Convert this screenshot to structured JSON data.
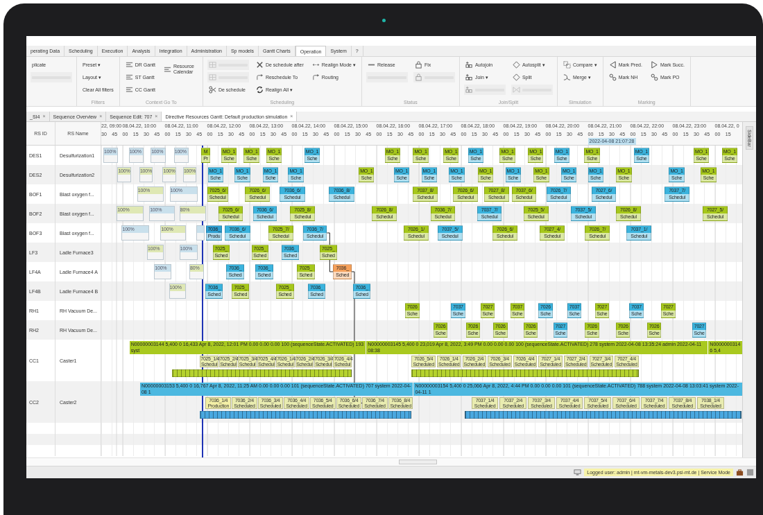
{
  "ribbon_tabs": [
    {
      "label": "perating Data",
      "selected": false
    },
    {
      "label": "Scheduling",
      "selected": false
    },
    {
      "label": "Execution",
      "selected": false
    },
    {
      "label": "Analysis",
      "selected": false
    },
    {
      "label": "Integration",
      "selected": false
    },
    {
      "label": "Administration",
      "selected": false
    },
    {
      "label": "Sp models",
      "selected": false
    },
    {
      "label": "Gantt Charts",
      "selected": false
    },
    {
      "label": "Operation",
      "selected": true
    },
    {
      "label": "System",
      "selected": false
    },
    {
      "label": "?",
      "selected": false
    }
  ],
  "ribbon_groups": [
    {
      "columns": [
        [
          {
            "label": "plicate",
            "disabled": false
          },
          {
            "disabled": true
          }
        ]
      ]
    },
    {
      "label": "Filters",
      "columns": [
        [
          {
            "label": "Preset ▾",
            "disabled": false
          },
          {
            "label": "Layout ▾",
            "disabled": false
          },
          {
            "label": "Clear All filters",
            "disabled": false
          }
        ]
      ]
    },
    {
      "label": "Context Go To",
      "columns": [
        [
          {
            "label": "DR Gantt",
            "disabled": false
          },
          {
            "label": "ST Gantt",
            "disabled": false
          },
          {
            "label": "CC Gantt",
            "disabled": false
          }
        ],
        [
          {
            "label": "Resource Calendar",
            "disabled": false
          }
        ]
      ]
    },
    {
      "label": "Scheduling",
      "columns": [
        [
          {
            "disabled": true
          },
          {
            "disabled": true
          },
          {
            "label": "De schedule",
            "disabled": false
          }
        ],
        [
          {
            "label": "De schedule after",
            "disabled": false
          },
          {
            "label": "Reschedule To",
            "disabled": false
          },
          {
            "label": "Realign All ▾",
            "disabled": false
          }
        ],
        [
          {
            "label": "Realign Mode ▾",
            "disabled": false
          },
          {
            "label": "Routing",
            "disabled": false
          }
        ]
      ]
    },
    {
      "label": "Status",
      "columns": [
        [
          {
            "label": "Release",
            "disabled": false
          },
          {
            "disabled": true
          }
        ],
        [
          {
            "label": "Fix",
            "disabled": false
          },
          {
            "disabled": true
          }
        ]
      ]
    },
    {
      "label": "Join/Split",
      "columns": [
        [
          {
            "label": "Autojoin",
            "disabled": false
          },
          {
            "label": "Join ▾",
            "disabled": false
          },
          {
            "disabled": true
          }
        ],
        [
          {
            "label": "Autosplit ▾",
            "disabled": false
          },
          {
            "label": "Split",
            "disabled": false
          },
          {
            "disabled": true
          }
        ]
      ]
    },
    {
      "label": "Simulation",
      "columns": [
        [
          {
            "label": "Compare ▾",
            "disabled": false
          },
          {
            "label": "Merge ▾",
            "disabled": false
          }
        ]
      ]
    },
    {
      "label": "Marking",
      "columns": [
        [
          {
            "label": "Mark Pred.",
            "disabled": false
          },
          {
            "label": "Mark NH",
            "disabled": false
          }
        ],
        [
          {
            "label": "Mark Succ.",
            "disabled": false
          },
          {
            "label": "Mark PO",
            "disabled": false
          }
        ]
      ]
    }
  ],
  "document_tabs": [
    {
      "label": "_SI4",
      "close": "×",
      "selected": false
    },
    {
      "label": "Sequence Overview",
      "close": "×",
      "selected": false
    },
    {
      "label": "Sequence Edit: 707",
      "close": "×",
      "selected": false
    },
    {
      "label": "Directive Resources Gantt: Default production simulation",
      "close": "×",
      "selected": true
    }
  ],
  "gantt": {
    "columns": [
      "RS ID",
      "RS Name"
    ],
    "hours": [
      {
        "label": "22, 09:00",
        "minutes": [
          "30",
          "45"
        ]
      },
      {
        "label": "08.04.22, 10:00",
        "minutes": [
          "00",
          "15",
          "30",
          "45"
        ]
      },
      {
        "label": "08.04.22, 11:00",
        "minutes": [
          "00",
          "15",
          "30",
          "45"
        ]
      },
      {
        "label": "08.04.22, 12:00",
        "minutes": [
          "00",
          "15",
          "30",
          "45"
        ]
      },
      {
        "label": "08.04.22, 13:00",
        "minutes": [
          "00",
          "15",
          "30",
          "45"
        ]
      },
      {
        "label": "08.04.22, 14:00",
        "minutes": [
          "00",
          "15",
          "30",
          "45"
        ]
      },
      {
        "label": "08.04.22, 15:00",
        "minutes": [
          "00",
          "15",
          "30",
          "45"
        ]
      },
      {
        "label": "08.04.22, 16:00",
        "minutes": [
          "00",
          "15",
          "30",
          "45"
        ]
      },
      {
        "label": "08.04.22, 17:00",
        "minutes": [
          "00",
          "15",
          "30",
          "45"
        ]
      },
      {
        "label": "08.04.22, 18:00",
        "minutes": [
          "00",
          "15",
          "30",
          "45"
        ]
      },
      {
        "label": "08.04.22, 19:00",
        "minutes": [
          "00",
          "15",
          "30",
          "45"
        ]
      },
      {
        "label": "08.04.22, 20:00",
        "minutes": [
          "00",
          "15",
          "30",
          "45"
        ]
      },
      {
        "label": "08.04.22, 21:00",
        "minutes": [
          "00",
          "15",
          "30",
          "45"
        ]
      },
      {
        "label": "08.04.22, 22:00",
        "minutes": [
          "00",
          "15",
          "30",
          "45"
        ]
      },
      {
        "label": "08.04.22, 23:00",
        "minutes": [
          "00",
          "15",
          "30",
          "45"
        ]
      },
      {
        "label": "08.04.22, 0",
        "minutes": [
          "00",
          "15"
        ]
      }
    ],
    "now_marker": {
      "label": "2022-04-08 21:07:28"
    },
    "rows": [
      {
        "id": "DES1",
        "name": "Desulfurization1",
        "kind": "unit",
        "bars": [
          {
            "kind": "past",
            "color": "#c9e0ec",
            "lines": [
              "100%"
            ]
          },
          {
            "kind": "past",
            "color": "#c9e0ec",
            "lines": [
              "100%"
            ]
          },
          {
            "kind": "past",
            "color": "#c9e0ec",
            "lines": [
              "100%"
            ]
          },
          {
            "kind": "past",
            "color": "#c9e0ec",
            "lines": [
              "100%"
            ]
          },
          {
            "kind": "job",
            "color": "#a6c71b",
            "lines": [
              "M",
              "Pr"
            ]
          },
          {
            "kind": "job",
            "color": "#a6c71b",
            "lines": [
              "MO_1",
              "Sche"
            ]
          },
          {
            "kind": "job",
            "color": "#a6c71b",
            "lines": [
              "MO_1",
              "Sche"
            ]
          },
          {
            "kind": "job",
            "color": "#a6c71b",
            "lines": [
              "MO_1",
              "Sche"
            ]
          },
          {
            "kind": "job",
            "color": "#3bb3dd",
            "lines": [
              "MO_1",
              "Sche"
            ]
          },
          {
            "kind": "job",
            "color": "#a6c71b",
            "lines": [
              "MO_1",
              "Sche"
            ]
          },
          {
            "kind": "job",
            "color": "#a6c71b",
            "lines": [
              "MO_1",
              "Sche"
            ]
          },
          {
            "kind": "job",
            "color": "#a6c71b",
            "lines": [
              "MO_1",
              "Sche"
            ]
          },
          {
            "kind": "job",
            "color": "#3bb3dd",
            "lines": [
              "MO_1",
              "Sche"
            ]
          },
          {
            "kind": "job",
            "color": "#a6c71b",
            "lines": [
              "MO_1",
              "Sche"
            ]
          },
          {
            "kind": "job",
            "color": "#a6c71b",
            "lines": [
              "MO_1",
              "Sche"
            ]
          },
          {
            "kind": "job",
            "color": "#3bb3dd",
            "lines": [
              "MO_1",
              "Sche"
            ]
          },
          {
            "kind": "job",
            "color": "#a6c71b",
            "lines": [
              "MO_1",
              "Sche"
            ]
          },
          {
            "kind": "job",
            "color": "#3bb3dd",
            "lines": [
              "MO_1",
              "Sche"
            ]
          },
          {
            "kind": "job",
            "color": "#a6c71b",
            "lines": [
              "MO_1",
              "Sche"
            ]
          },
          {
            "kind": "job",
            "color": "#a6c71b",
            "lines": [
              "MO_1",
              "Sche"
            ]
          }
        ]
      },
      {
        "id": "DES2",
        "name": "Desulfurization2",
        "kind": "unit",
        "bars": [
          {
            "kind": "past",
            "color": "#dfe8b4",
            "lines": [
              "100%"
            ]
          },
          {
            "kind": "past",
            "color": "#dfe8b4",
            "lines": [
              "100%"
            ]
          },
          {
            "kind": "past",
            "color": "#dfe8b4",
            "lines": [
              "100%"
            ]
          },
          {
            "kind": "past",
            "color": "#dfe8b4",
            "lines": [
              "100%"
            ]
          },
          {
            "kind": "job",
            "color": "#3bb3dd",
            "lines": [
              "MO_1",
              "Sche"
            ]
          },
          {
            "kind": "job",
            "color": "#3bb3dd",
            "lines": [
              "MO_1",
              "Sche"
            ]
          },
          {
            "kind": "job",
            "color": "#3bb3dd",
            "lines": [
              "MO_1",
              "Sche"
            ]
          },
          {
            "kind": "job",
            "color": "#3bb3dd",
            "lines": [
              "MO_1",
              "Sche"
            ]
          },
          {
            "kind": "job",
            "color": "#a6c71b",
            "lines": [
              "MO_1",
              "Sche"
            ]
          },
          {
            "kind": "job",
            "color": "#3bb3dd",
            "lines": [
              "MO_1",
              "Sche"
            ]
          },
          {
            "kind": "job",
            "color": "#3bb3dd",
            "lines": [
              "MO_1",
              "Sche"
            ]
          },
          {
            "kind": "job",
            "color": "#3bb3dd",
            "lines": [
              "MO_1",
              "Sche"
            ]
          },
          {
            "kind": "job",
            "color": "#a6c71b",
            "lines": [
              "MO_1",
              "Sche"
            ]
          },
          {
            "kind": "job",
            "color": "#3bb3dd",
            "lines": [
              "MO_1",
              "Sche"
            ]
          },
          {
            "kind": "job",
            "color": "#a6c71b",
            "lines": [
              "MO_1",
              "Sche"
            ]
          },
          {
            "kind": "job",
            "color": "#3bb3dd",
            "lines": [
              "MO_1",
              "Sche"
            ]
          },
          {
            "kind": "job",
            "color": "#3bb3dd",
            "lines": [
              "MO_1",
              "Sche"
            ]
          },
          {
            "kind": "job",
            "color": "#a6c71b",
            "lines": [
              "MO_1",
              "Sche"
            ]
          },
          {
            "kind": "job",
            "color": "#3bb3dd",
            "lines": [
              "MO_1",
              "Sche"
            ]
          },
          {
            "kind": "job",
            "color": "#a6c71b",
            "lines": [
              "MO_1",
              "Sche"
            ]
          }
        ]
      },
      {
        "id": "BOF1",
        "name": "Blast oxygen f...",
        "kind": "unit",
        "bars": [
          {
            "kind": "past",
            "color": "#dfe8b4",
            "lines": [
              "100%"
            ]
          },
          {
            "kind": "past",
            "color": "#c9e0ec",
            "lines": [
              "100%"
            ]
          },
          {
            "kind": "job",
            "color": "#a6c71b",
            "lines": [
              "7025_6/",
              "Schedul"
            ]
          },
          {
            "kind": "job",
            "color": "#a6c71b",
            "lines": [
              "7026_6/",
              "Schedul"
            ]
          },
          {
            "kind": "job",
            "color": "#3bb3dd",
            "lines": [
              "7036_6/",
              "Schedul"
            ]
          },
          {
            "kind": "job",
            "color": "#3bb3dd",
            "lines": [
              "7036_8/",
              "Schedul"
            ]
          },
          {
            "kind": "job",
            "color": "#a6c71b",
            "lines": [
              "7037_8/",
              "Schedul"
            ]
          },
          {
            "kind": "job",
            "color": "#a6c71b",
            "lines": [
              "7026_6/",
              "Schedul"
            ]
          },
          {
            "kind": "job",
            "color": "#a6c71b",
            "lines": [
              "7027_8/",
              "Schedul"
            ]
          },
          {
            "kind": "job",
            "color": "#a6c71b",
            "lines": [
              "7037_6/",
              "Schedul"
            ]
          },
          {
            "kind": "job",
            "color": "#3bb3dd",
            "lines": [
              "7026_7/",
              "Schedul"
            ]
          },
          {
            "kind": "job",
            "color": "#3bb3dd",
            "lines": [
              "7027_6/",
              "Schedul"
            ]
          },
          {
            "kind": "job",
            "color": "#3bb3dd",
            "lines": [
              "7037_7/",
              "Schedul"
            ]
          }
        ]
      },
      {
        "id": "BOF2",
        "name": "Blast oxygen f...",
        "kind": "unit",
        "bars": [
          {
            "kind": "past",
            "color": "#dfe8b4",
            "lines": [
              "100%"
            ]
          },
          {
            "kind": "past",
            "color": "#c9e0ec",
            "lines": [
              "100%"
            ]
          },
          {
            "kind": "past",
            "color": "#dfe8b4",
            "lines": [
              "80%"
            ]
          },
          {
            "kind": "job",
            "color": "#a6c71b",
            "lines": [
              "7025_6/",
              "Schedul"
            ]
          },
          {
            "kind": "job",
            "color": "#3bb3dd",
            "lines": [
              "7036_6/",
              "Schedul"
            ]
          },
          {
            "kind": "job",
            "color": "#a6c71b",
            "lines": [
              "7025_8/",
              "Schedul"
            ]
          },
          {
            "kind": "job",
            "color": "#a6c71b",
            "lines": [
              "7026_8/",
              "Schedul"
            ]
          },
          {
            "kind": "job",
            "color": "#a6c71b",
            "lines": [
              "7036_7/",
              "Schedul"
            ]
          },
          {
            "kind": "job",
            "color": "#3bb3dd",
            "lines": [
              "7037_7/",
              "Schedul"
            ]
          },
          {
            "kind": "job",
            "color": "#a6c71b",
            "lines": [
              "7025_5/",
              "Schedul"
            ]
          },
          {
            "kind": "job",
            "color": "#3bb3dd",
            "lines": [
              "7037_5/",
              "Schedul"
            ]
          },
          {
            "kind": "job",
            "color": "#a6c71b",
            "lines": [
              "7026_8/",
              "Schedul"
            ]
          },
          {
            "kind": "job",
            "color": "#a6c71b",
            "lines": [
              "7027_5/",
              "Schedul"
            ]
          }
        ]
      },
      {
        "id": "BOF3",
        "name": "Blast oxygen f...",
        "kind": "unit",
        "bars": [
          {
            "kind": "past",
            "color": "#c9e0ec",
            "lines": [
              "100%"
            ]
          },
          {
            "kind": "past",
            "color": "#dfe8b4",
            "lines": [
              "100%"
            ]
          },
          {
            "kind": "past",
            "color": "#c9e0ec"
          },
          {
            "kind": "job",
            "color": "#2e9fd2",
            "lines": [
              "7036_",
              "Produ"
            ]
          },
          {
            "kind": "job",
            "color": "#3bb3dd",
            "lines": [
              "7036_6/",
              "Schedul"
            ]
          },
          {
            "kind": "job",
            "color": "#a6c71b",
            "lines": [
              "7025_7/",
              "Schedul"
            ]
          },
          {
            "kind": "job",
            "color": "#3bb3dd",
            "lines": [
              "7036_7/",
              "Schedul"
            ]
          },
          {
            "kind": "job",
            "color": "#a6c71b",
            "lines": [
              "7026_1/",
              "Schedul"
            ]
          },
          {
            "kind": "job",
            "color": "#3bb3dd",
            "lines": [
              "7037_5/",
              "Schedul"
            ]
          },
          {
            "kind": "job",
            "color": "#a6c71b",
            "lines": [
              "7026_6/",
              "Schedul"
            ]
          },
          {
            "kind": "job",
            "color": "#a6c71b",
            "lines": [
              "7027_4/",
              "Schedul"
            ]
          },
          {
            "kind": "job",
            "color": "#a6c71b",
            "lines": [
              "7026_7/",
              "Schedul"
            ]
          },
          {
            "kind": "job",
            "color": "#3bb3dd",
            "lines": [
              "7037_1/",
              "Schedul"
            ]
          }
        ]
      },
      {
        "id": "LF3",
        "name": "Ladle Furnace3",
        "kind": "unit",
        "bars": [
          {
            "kind": "past",
            "color": "#dfe8b4",
            "lines": [
              "100%"
            ]
          },
          {
            "kind": "past",
            "color": "#c9e0ec",
            "lines": [
              "100%"
            ]
          },
          {
            "kind": "job",
            "color": "#a6c71b",
            "lines": [
              "7025_",
              "Sched"
            ]
          },
          {
            "kind": "job",
            "color": "#a6c71b",
            "lines": [
              "7025_",
              "Sched"
            ]
          },
          {
            "kind": "job",
            "color": "#3bb3dd",
            "lines": [
              "7036_",
              "Sched"
            ]
          },
          {
            "kind": "job",
            "color": "#a6c71b",
            "lines": [
              "7025_",
              "Sched"
            ]
          }
        ]
      },
      {
        "id": "LF4A",
        "name": "Ladle Furnace4 A",
        "kind": "unit",
        "bars": [
          {
            "kind": "past",
            "color": "#c9e0ec",
            "lines": [
              "100%"
            ]
          },
          {
            "kind": "past",
            "color": "#dfe8b4",
            "lines": [
              "80%"
            ]
          },
          {
            "kind": "job",
            "color": "#3bb3dd",
            "lines": [
              "7036_",
              "Sched"
            ]
          },
          {
            "kind": "job",
            "color": "#3bb3dd",
            "lines": [
              "7036_",
              "Sched"
            ]
          },
          {
            "kind": "job",
            "color": "#a6c71b",
            "lines": [
              "7025_",
              "Sched"
            ]
          },
          {
            "kind": "job",
            "color": "#f5a05a",
            "lines": [
              "7036_",
              "Sched"
            ]
          }
        ]
      },
      {
        "id": "LF4B",
        "name": "Ladle Furnace4 B",
        "kind": "unit",
        "bars": [
          {
            "kind": "past",
            "color": "#dfe8b4",
            "lines": [
              "100%"
            ]
          },
          {
            "kind": "job",
            "color": "#3bb3dd",
            "lines": [
              "7036_",
              "Sched"
            ]
          },
          {
            "kind": "job",
            "color": "#a6c71b",
            "lines": [
              "7025_",
              "Sched"
            ]
          },
          {
            "kind": "job",
            "color": "#a6c71b",
            "lines": [
              "7025_",
              "Sched"
            ]
          },
          {
            "kind": "job",
            "color": "#3bb3dd",
            "lines": [
              "7036_",
              "Sched"
            ]
          },
          {
            "kind": "job",
            "color": "#3bb3dd",
            "lines": [
              "7036_",
              "Sched"
            ]
          }
        ]
      },
      {
        "id": "RH1",
        "name": "RH Vacuum De...",
        "kind": "unit",
        "bars": [
          {
            "kind": "job",
            "color": "#a6c71b",
            "lines": [
              "7026",
              "Sche"
            ]
          },
          {
            "kind": "job",
            "color": "#3bb3dd",
            "lines": [
              "7037",
              "Sche"
            ]
          },
          {
            "kind": "job",
            "color": "#a6c71b",
            "lines": [
              "7027",
              "Sche"
            ]
          },
          {
            "kind": "job",
            "color": "#a6c71b",
            "lines": [
              "7037",
              "Sche"
            ]
          },
          {
            "kind": "job",
            "color": "#3bb3dd",
            "lines": [
              "7026",
              "Sche"
            ]
          },
          {
            "kind": "job",
            "color": "#3bb3dd",
            "lines": [
              "7037",
              "Sche"
            ]
          },
          {
            "kind": "job",
            "color": "#a6c71b",
            "lines": [
              "7027",
              "Sche"
            ]
          },
          {
            "kind": "job",
            "color": "#3bb3dd",
            "lines": [
              "7037",
              "Sche"
            ]
          },
          {
            "kind": "job",
            "color": "#a6c71b",
            "lines": [
              "7027",
              "Sche"
            ]
          }
        ]
      },
      {
        "id": "RH2",
        "name": "RH Vacuum De...",
        "kind": "unit",
        "bars": [
          {
            "kind": "job",
            "color": "#a6c71b",
            "lines": [
              "7026",
              "Sche"
            ]
          },
          {
            "kind": "job",
            "color": "#a6c71b",
            "lines": [
              "7026",
              "Sche"
            ]
          },
          {
            "kind": "job",
            "color": "#a6c71b",
            "lines": [
              "7026",
              "Sche"
            ]
          },
          {
            "kind": "job",
            "color": "#a6c71b",
            "lines": [
              "7026",
              "Sche"
            ]
          },
          {
            "kind": "job",
            "color": "#3bb3dd",
            "lines": [
              "7027",
              "Sche"
            ]
          },
          {
            "kind": "job",
            "color": "#a6c71b",
            "lines": [
              "7026",
              "Sche"
            ]
          },
          {
            "kind": "job",
            "color": "#a6c71b",
            "lines": [
              "7026",
              "Sche"
            ]
          },
          {
            "kind": "job",
            "color": "#a6c71b",
            "lines": [
              "7026",
              "Sche"
            ]
          },
          {
            "kind": "job",
            "color": "#3bb3dd",
            "lines": [
              "7027",
              "Sche"
            ]
          }
        ]
      },
      {
        "id": "CC1",
        "name": "Caster1",
        "kind": "caster",
        "sequences": [
          {
            "color": "#a9c91f",
            "text": "N00000003144 5,400 0 16,433 Apr 8, 2022, 12:01 PM 0.00 0.00 0.00 100 (sequenceState.ACTIVATED) 193 syst"
          },
          {
            "color": "#a9c91f",
            "text": "N00000003145 5,400 0 23,019 Apr 8, 2022, 3:49 PM 0.00 0.00 0.00 100 (sequenceState.ACTIVATED) 278 system 2022-04-08 13:35:24 admin 2022-04-11 08:38"
          },
          {
            "color": "#a9c91f",
            "text": "N00000003146 5,4"
          }
        ],
        "jobs": [
          {
            "color": "#e9ecb0",
            "lines": [
              "7025_1/4",
              "Schedul"
            ]
          },
          {
            "color": "#e9ecb0",
            "lines": [
              "7025_2/4",
              "Schedul"
            ]
          },
          {
            "color": "#e9ecb0",
            "lines": [
              "7025_3/4",
              "Schedul"
            ]
          },
          {
            "color": "#e9ecb0",
            "lines": [
              "7025_4/4",
              "Schedul"
            ]
          },
          {
            "color": "#e9ecb0",
            "lines": [
              "7026_1/4",
              "Schedul"
            ]
          },
          {
            "color": "#e9ecb0",
            "lines": [
              "7026_2/4",
              "Schedul"
            ]
          },
          {
            "color": "#e9ecb0",
            "lines": [
              "7026_3/4",
              "Schedul"
            ]
          },
          {
            "color": "#e9ecb0",
            "lines": [
              "7026_4/4",
              "Schedul"
            ]
          },
          {
            "color": "#e9ecb0",
            "lines": [
              "7026_5/4",
              "Scheduled"
            ]
          },
          {
            "color": "#e9ecb0",
            "lines": [
              "7026_1/4",
              "Scheduled"
            ]
          },
          {
            "color": "#e9ecb0",
            "lines": [
              "7026_2/4",
              "Scheduled"
            ]
          },
          {
            "color": "#e9ecb0",
            "lines": [
              "7026_3/4",
              "Scheduled"
            ]
          },
          {
            "color": "#e9ecb0",
            "lines": [
              "7026_4/4",
              "Scheduled"
            ]
          },
          {
            "color": "#e9ecb0",
            "lines": [
              "7027_1/4",
              "Scheduled"
            ]
          },
          {
            "color": "#e9ecb0",
            "lines": [
              "7027_2/4",
              "Scheduled"
            ]
          },
          {
            "color": "#e9ecb0",
            "lines": [
              "7027_3/4",
              "Scheduled"
            ]
          },
          {
            "color": "#e9ecb0",
            "lines": [
              "7027_4/4",
              "Scheduled"
            ]
          }
        ],
        "strips": [
          {
            "color": "#b5d22e"
          },
          {
            "color": "#b5d22e"
          }
        ]
      },
      {
        "id": "CC2",
        "name": "Caster2",
        "kind": "caster",
        "sequences": [
          {
            "color": "#4cb8e0",
            "text": "N00000003153 5,400 0 16,767 Apr 8, 2022, 11:25 AM 0.00 0.00 0.00 101 (sequenceState.ACTIVATED) 707 system 2022-04-08 1"
          },
          {
            "color": "#4cb8e0",
            "text": "N00000003154 5,400 0 25,066 Apr 8, 2022, 4:44 PM 0.00 0.00 0.00 101 (sequenceState.ACTIVATED) 788 system 2022-04-08 13:03:41 system 2022-04-11 1"
          }
        ],
        "jobs": [
          {
            "color": "#f3efa6",
            "lines": [
              "7036_1/4",
              "Production"
            ]
          },
          {
            "color": "#e9ecb0",
            "lines": [
              "7036_2/4",
              "Scheduled"
            ]
          },
          {
            "color": "#e9ecb0",
            "lines": [
              "7036_3/4",
              "Scheduled"
            ]
          },
          {
            "color": "#e9ecb0",
            "lines": [
              "7036_4/4",
              "Scheduled"
            ]
          },
          {
            "color": "#e9ecb0",
            "lines": [
              "7036_5/4",
              "Scheduled"
            ]
          },
          {
            "color": "#e9ecb0",
            "lines": [
              "7036_6/4",
              "Scheduled"
            ]
          },
          {
            "color": "#e9ecb0",
            "lines": [
              "7036_7/4",
              "Scheduled"
            ]
          },
          {
            "color": "#e9ecb0",
            "lines": [
              "7036_8/4",
              "Scheduled"
            ]
          },
          {
            "color": "#e9ecb0",
            "lines": [
              "7037_1/4",
              "Scheduled"
            ]
          },
          {
            "color": "#e9ecb0",
            "lines": [
              "7037_2/4",
              "Scheduled"
            ]
          },
          {
            "color": "#e9ecb0",
            "lines": [
              "7037_3/4",
              "Scheduled"
            ]
          },
          {
            "color": "#e9ecb0",
            "lines": [
              "7037_4/4",
              "Scheduled"
            ]
          },
          {
            "color": "#e9ecb0",
            "lines": [
              "7037_5/4",
              "Scheduled"
            ]
          },
          {
            "color": "#e9ecb0",
            "lines": [
              "7037_6/4",
              "Scheduled"
            ]
          },
          {
            "color": "#e9ecb0",
            "lines": [
              "7037_7/4",
              "Scheduled"
            ]
          },
          {
            "color": "#e9ecb0",
            "lines": [
              "7037_8/4",
              "Scheduled"
            ]
          },
          {
            "color": "#e9ecb0",
            "lines": [
              "7038_1/4",
              "Scheduled"
            ]
          }
        ],
        "strips": [
          {
            "color": "#4aa8e0"
          },
          {
            "color": "#4aa8e0"
          }
        ]
      }
    ]
  },
  "sidebar": {
    "label": "SideBar"
  },
  "status_bar": {
    "text": "Logged user: admin | mt-vm-metals-dev3.psi-mt.de | Service Mode"
  }
}
